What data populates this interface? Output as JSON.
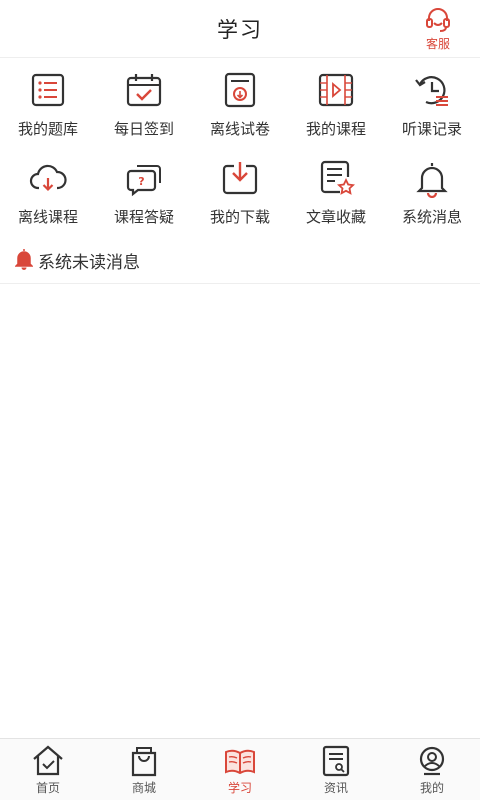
{
  "header": {
    "title": "学习",
    "customer_service": "客服"
  },
  "grid": [
    {
      "label": "我的题库",
      "icon": "question-bank-icon"
    },
    {
      "label": "每日签到",
      "icon": "calendar-check-icon"
    },
    {
      "label": "离线试卷",
      "icon": "offline-paper-icon"
    },
    {
      "label": "我的课程",
      "icon": "course-video-icon"
    },
    {
      "label": "听课记录",
      "icon": "history-icon"
    },
    {
      "label": "离线课程",
      "icon": "cloud-download-icon"
    },
    {
      "label": "课程答疑",
      "icon": "chat-question-icon"
    },
    {
      "label": "我的下载",
      "icon": "download-icon"
    },
    {
      "label": "文章收藏",
      "icon": "article-star-icon"
    },
    {
      "label": "系统消息",
      "icon": "bell-icon"
    }
  ],
  "notice": {
    "label": "系统未读消息"
  },
  "tabbar": [
    {
      "label": "首页",
      "icon": "home-icon"
    },
    {
      "label": "商城",
      "icon": "shopping-bag-icon"
    },
    {
      "label": "学习",
      "icon": "book-icon"
    },
    {
      "label": "资讯",
      "icon": "news-icon"
    },
    {
      "label": "我的",
      "icon": "profile-icon"
    }
  ],
  "colors": {
    "accent": "#d9473a",
    "icon": "#333333"
  }
}
